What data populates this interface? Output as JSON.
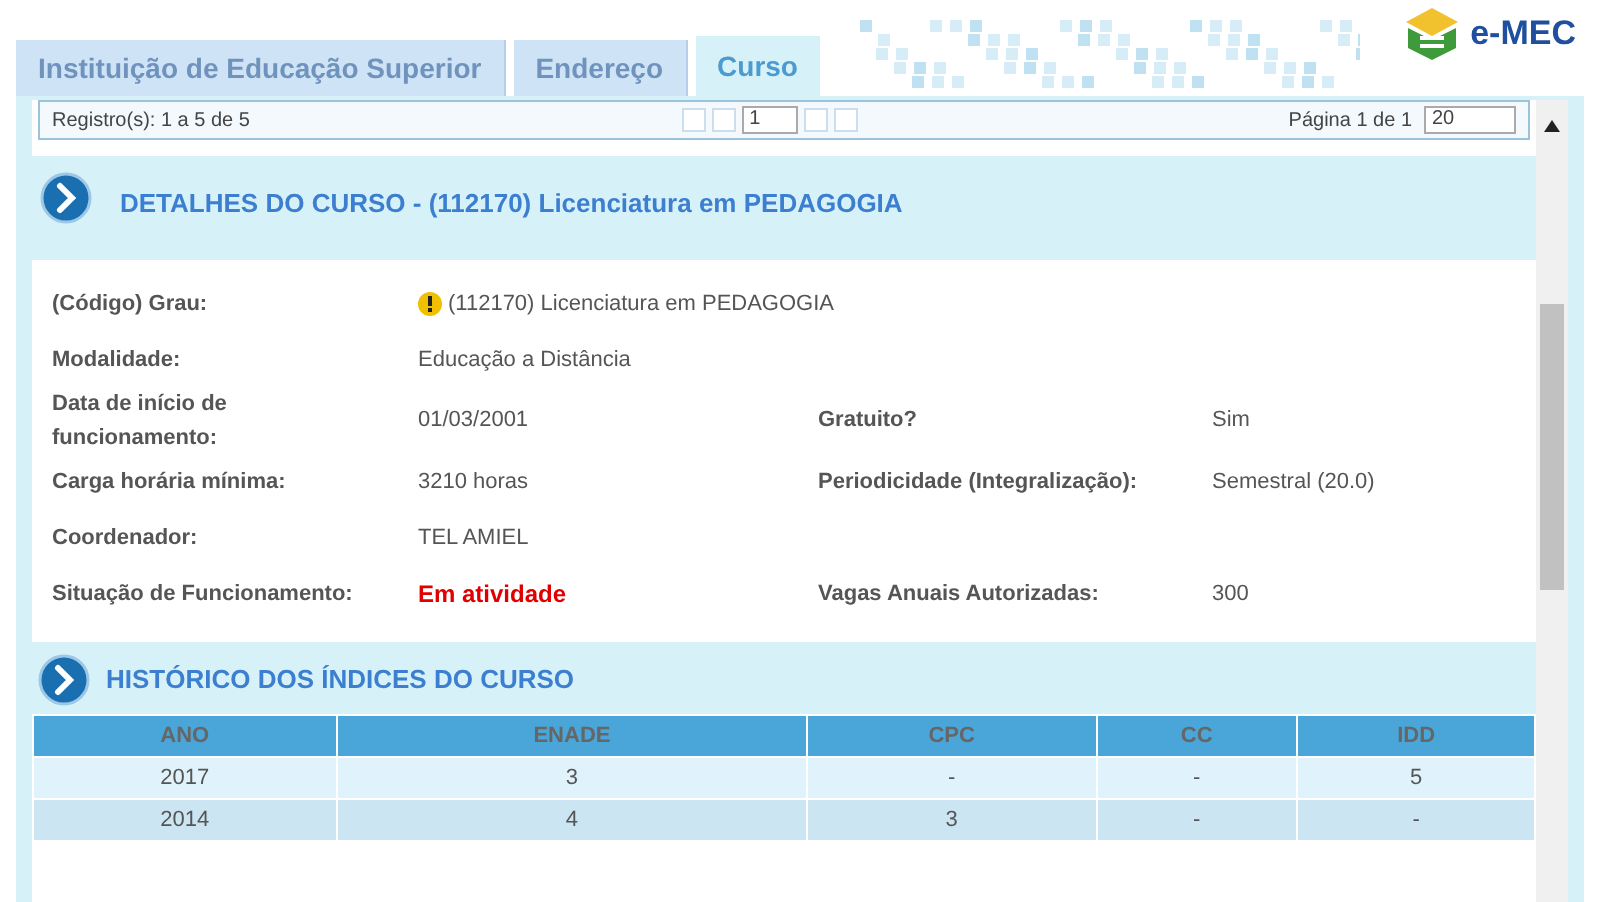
{
  "tabs": [
    {
      "label": "Instituição de Educação Superior",
      "selected": false
    },
    {
      "label": "Endereço",
      "selected": false
    },
    {
      "label": "Curso",
      "selected": true
    }
  ],
  "logo": {
    "text": "e-MEC"
  },
  "pager": {
    "records": "Registro(s): 1 a 5 de 5",
    "page_select": "1",
    "page_info": "Página 1 de 1",
    "size_select": "20"
  },
  "details": {
    "title": "DETALHES DO CURSO - (112170) Licenciatura em PEDAGOGIA",
    "rows": [
      {
        "label": "(Código) Grau:",
        "value": "(112170) Licenciatura em PEDAGOGIA",
        "kind": "warning"
      },
      {
        "label": "Modalidade:",
        "value": "Educação a Distância",
        "kind": "plain"
      },
      {
        "label": "Data de início de funcionamento:",
        "value": "01/03/2001",
        "kind": "plain",
        "label2": "Gratuito?",
        "value2": "Sim"
      },
      {
        "label": "Carga horária mínima:",
        "value": "3210 horas",
        "kind": "plain",
        "label2": "Periodicidade (Integralização):",
        "value2": "Semestral (20.0)"
      },
      {
        "label": "Coordenador:",
        "value": "TEL AMIEL",
        "kind": "plain"
      },
      {
        "label": "Situação de Funcionamento:",
        "value": "Em atividade",
        "kind": "status",
        "label2": "Vagas Anuais Autorizadas:",
        "value2": "300"
      }
    ]
  },
  "history": {
    "title": "HISTÓRICO DOS ÍNDICES DO CURSO",
    "columns": [
      "ANO",
      "ENADE",
      "CPC",
      "CC",
      "IDD"
    ],
    "rows": [
      [
        "2017",
        "3",
        "-",
        "-",
        "5"
      ],
      [
        "2014",
        "4",
        "3",
        "-",
        "-"
      ]
    ]
  }
}
